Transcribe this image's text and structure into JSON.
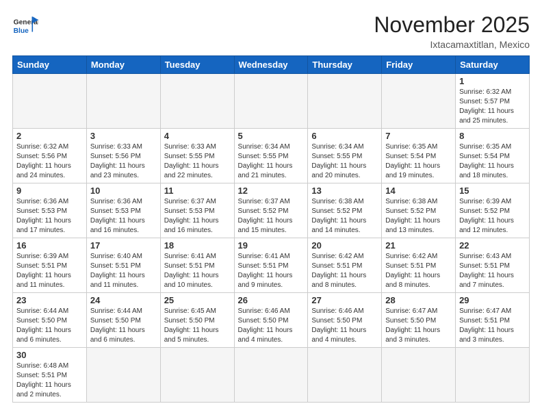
{
  "header": {
    "logo_general": "General",
    "logo_blue": "Blue",
    "month": "November 2025",
    "location": "Ixtacamaxtitlan, Mexico"
  },
  "days_of_week": [
    "Sunday",
    "Monday",
    "Tuesday",
    "Wednesday",
    "Thursday",
    "Friday",
    "Saturday"
  ],
  "weeks": [
    [
      {
        "day": "",
        "info": ""
      },
      {
        "day": "",
        "info": ""
      },
      {
        "day": "",
        "info": ""
      },
      {
        "day": "",
        "info": ""
      },
      {
        "day": "",
        "info": ""
      },
      {
        "day": "",
        "info": ""
      },
      {
        "day": "1",
        "info": "Sunrise: 6:32 AM\nSunset: 5:57 PM\nDaylight: 11 hours and 25 minutes."
      }
    ],
    [
      {
        "day": "2",
        "info": "Sunrise: 6:32 AM\nSunset: 5:56 PM\nDaylight: 11 hours and 24 minutes."
      },
      {
        "day": "3",
        "info": "Sunrise: 6:33 AM\nSunset: 5:56 PM\nDaylight: 11 hours and 23 minutes."
      },
      {
        "day": "4",
        "info": "Sunrise: 6:33 AM\nSunset: 5:55 PM\nDaylight: 11 hours and 22 minutes."
      },
      {
        "day": "5",
        "info": "Sunrise: 6:34 AM\nSunset: 5:55 PM\nDaylight: 11 hours and 21 minutes."
      },
      {
        "day": "6",
        "info": "Sunrise: 6:34 AM\nSunset: 5:55 PM\nDaylight: 11 hours and 20 minutes."
      },
      {
        "day": "7",
        "info": "Sunrise: 6:35 AM\nSunset: 5:54 PM\nDaylight: 11 hours and 19 minutes."
      },
      {
        "day": "8",
        "info": "Sunrise: 6:35 AM\nSunset: 5:54 PM\nDaylight: 11 hours and 18 minutes."
      }
    ],
    [
      {
        "day": "9",
        "info": "Sunrise: 6:36 AM\nSunset: 5:53 PM\nDaylight: 11 hours and 17 minutes."
      },
      {
        "day": "10",
        "info": "Sunrise: 6:36 AM\nSunset: 5:53 PM\nDaylight: 11 hours and 16 minutes."
      },
      {
        "day": "11",
        "info": "Sunrise: 6:37 AM\nSunset: 5:53 PM\nDaylight: 11 hours and 16 minutes."
      },
      {
        "day": "12",
        "info": "Sunrise: 6:37 AM\nSunset: 5:52 PM\nDaylight: 11 hours and 15 minutes."
      },
      {
        "day": "13",
        "info": "Sunrise: 6:38 AM\nSunset: 5:52 PM\nDaylight: 11 hours and 14 minutes."
      },
      {
        "day": "14",
        "info": "Sunrise: 6:38 AM\nSunset: 5:52 PM\nDaylight: 11 hours and 13 minutes."
      },
      {
        "day": "15",
        "info": "Sunrise: 6:39 AM\nSunset: 5:52 PM\nDaylight: 11 hours and 12 minutes."
      }
    ],
    [
      {
        "day": "16",
        "info": "Sunrise: 6:39 AM\nSunset: 5:51 PM\nDaylight: 11 hours and 11 minutes."
      },
      {
        "day": "17",
        "info": "Sunrise: 6:40 AM\nSunset: 5:51 PM\nDaylight: 11 hours and 11 minutes."
      },
      {
        "day": "18",
        "info": "Sunrise: 6:41 AM\nSunset: 5:51 PM\nDaylight: 11 hours and 10 minutes."
      },
      {
        "day": "19",
        "info": "Sunrise: 6:41 AM\nSunset: 5:51 PM\nDaylight: 11 hours and 9 minutes."
      },
      {
        "day": "20",
        "info": "Sunrise: 6:42 AM\nSunset: 5:51 PM\nDaylight: 11 hours and 8 minutes."
      },
      {
        "day": "21",
        "info": "Sunrise: 6:42 AM\nSunset: 5:51 PM\nDaylight: 11 hours and 8 minutes."
      },
      {
        "day": "22",
        "info": "Sunrise: 6:43 AM\nSunset: 5:51 PM\nDaylight: 11 hours and 7 minutes."
      }
    ],
    [
      {
        "day": "23",
        "info": "Sunrise: 6:44 AM\nSunset: 5:50 PM\nDaylight: 11 hours and 6 minutes."
      },
      {
        "day": "24",
        "info": "Sunrise: 6:44 AM\nSunset: 5:50 PM\nDaylight: 11 hours and 6 minutes."
      },
      {
        "day": "25",
        "info": "Sunrise: 6:45 AM\nSunset: 5:50 PM\nDaylight: 11 hours and 5 minutes."
      },
      {
        "day": "26",
        "info": "Sunrise: 6:46 AM\nSunset: 5:50 PM\nDaylight: 11 hours and 4 minutes."
      },
      {
        "day": "27",
        "info": "Sunrise: 6:46 AM\nSunset: 5:50 PM\nDaylight: 11 hours and 4 minutes."
      },
      {
        "day": "28",
        "info": "Sunrise: 6:47 AM\nSunset: 5:50 PM\nDaylight: 11 hours and 3 minutes."
      },
      {
        "day": "29",
        "info": "Sunrise: 6:47 AM\nSunset: 5:51 PM\nDaylight: 11 hours and 3 minutes."
      }
    ],
    [
      {
        "day": "30",
        "info": "Sunrise: 6:48 AM\nSunset: 5:51 PM\nDaylight: 11 hours and 2 minutes."
      },
      {
        "day": "",
        "info": ""
      },
      {
        "day": "",
        "info": ""
      },
      {
        "day": "",
        "info": ""
      },
      {
        "day": "",
        "info": ""
      },
      {
        "day": "",
        "info": ""
      },
      {
        "day": "",
        "info": ""
      }
    ]
  ]
}
